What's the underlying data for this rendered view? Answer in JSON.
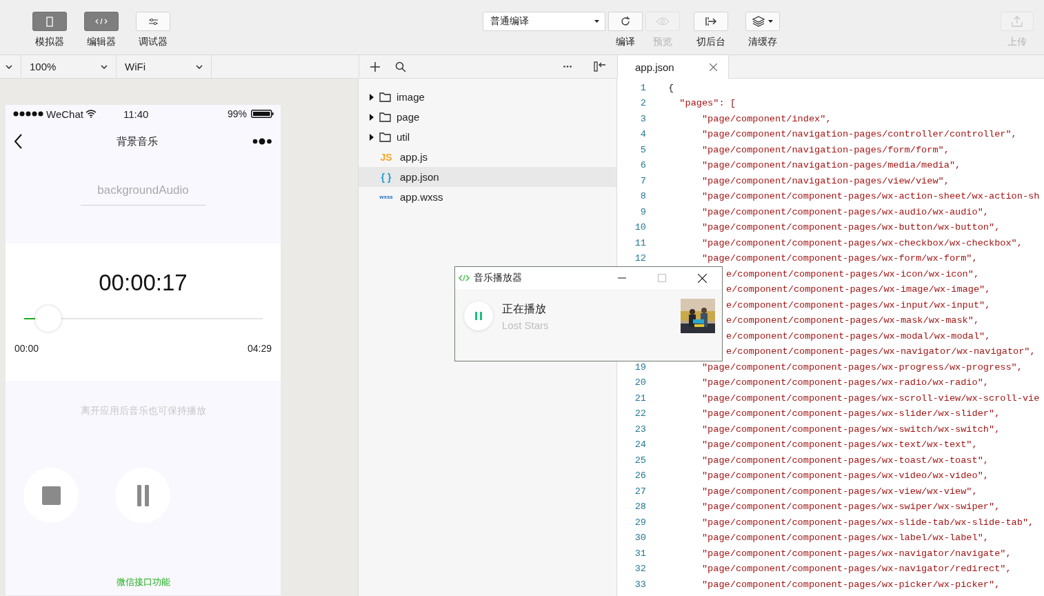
{
  "toolbar": {
    "modes": [
      {
        "label": "模拟器",
        "kind": "simulator",
        "selected": true
      },
      {
        "label": "编辑器",
        "kind": "editor",
        "selected": true
      },
      {
        "label": "调试器",
        "kind": "debugger",
        "selected": false
      }
    ],
    "compile_mode": {
      "value": "普通编译"
    },
    "actions": [
      {
        "label": "编译",
        "kind": "refresh",
        "disabled": false
      },
      {
        "label": "预览",
        "kind": "preview",
        "disabled": true
      }
    ],
    "tools": [
      {
        "label": "切后台",
        "kind": "background"
      },
      {
        "label": "清缓存",
        "kind": "cache"
      }
    ],
    "upload": {
      "label": "上传",
      "disabled": true
    }
  },
  "simulator_bar": {
    "zoom": "100%",
    "network": "WiFi"
  },
  "phone": {
    "status_bar": {
      "carrier": "WeChat",
      "time": "11:40",
      "battery": "99%"
    },
    "nav_title": "背景音乐",
    "section_title": "backgroundAudio",
    "elapsed": "00:00:17",
    "progress": {
      "level": 0.05,
      "start": "00:00",
      "end": "04:29"
    },
    "hint": "离开应用后音乐也可保持播放",
    "controls": [
      {
        "kind": "stop"
      },
      {
        "kind": "pause"
      }
    ],
    "footer": "微信接口功能"
  },
  "file_tree": [
    {
      "name": "image",
      "kind": "folder",
      "selected": false
    },
    {
      "name": "page",
      "kind": "folder",
      "selected": false
    },
    {
      "name": "util",
      "kind": "folder",
      "selected": false
    },
    {
      "name": "app.js",
      "kind": "file",
      "badge": "JS",
      "color": "#f5a623",
      "selected": false
    },
    {
      "name": "app.json",
      "kind": "file",
      "badge": "{ }",
      "color": "#1e9bd7",
      "selected": true
    },
    {
      "name": "app.wxss",
      "kind": "file",
      "badge": "wxss",
      "color": "#1a6fc4",
      "selected": false
    }
  ],
  "editor_tabs": [
    {
      "label": "app.json",
      "selected": true
    }
  ],
  "code_lines": [
    {
      "number": "1",
      "text": "{"
    },
    {
      "number": "2",
      "text": "  \"pages\": ["
    },
    {
      "number": "3",
      "text": "      \"page/component/index\","
    },
    {
      "number": "4",
      "text": "      \"page/component/navigation-pages/controller/controller\","
    },
    {
      "number": "5",
      "text": "      \"page/component/navigation-pages/form/form\","
    },
    {
      "number": "6",
      "text": "      \"page/component/navigation-pages/media/media\","
    },
    {
      "number": "7",
      "text": "      \"page/component/navigation-pages/view/view\","
    },
    {
      "number": "8",
      "text": "      \"page/component/component-pages/wx-action-sheet/wx-action-sh"
    },
    {
      "number": "9",
      "text": "      \"page/component/component-pages/wx-audio/wx-audio\","
    },
    {
      "number": "10",
      "text": "      \"page/component/component-pages/wx-button/wx-button\","
    },
    {
      "number": "11",
      "text": "      \"page/component/component-pages/wx-checkbox/wx-checkbox\","
    },
    {
      "number": "12",
      "text": "      \"page/component/component-pages/wx-form/wx-form\","
    },
    {
      "text": "e/component/component-pages/wx-icon/wx-icon\","
    },
    {
      "text": "e/component/component-pages/wx-image/wx-image\","
    },
    {
      "text": "e/component/component-pages/wx-input/wx-input\","
    },
    {
      "text": "e/component/component-pages/wx-mask/wx-mask\","
    },
    {
      "text": "e/component/component-pages/wx-modal/wx-modal\","
    },
    {
      "text": "e/component/component-pages/wx-navigator/wx-navigator\","
    },
    {
      "number": "19",
      "text": "      \"page/component/component-pages/wx-progress/wx-progress\","
    },
    {
      "number": "20",
      "text": "      \"page/component/component-pages/wx-radio/wx-radio\","
    },
    {
      "number": "21",
      "text": "      \"page/component/component-pages/wx-scroll-view/wx-scroll-vie"
    },
    {
      "number": "22",
      "text": "      \"page/component/component-pages/wx-slider/wx-slider\","
    },
    {
      "number": "23",
      "text": "      \"page/component/component-pages/wx-switch/wx-switch\","
    },
    {
      "number": "24",
      "text": "      \"page/component/component-pages/wx-text/wx-text\","
    },
    {
      "number": "25",
      "text": "      \"page/component/component-pages/wx-toast/wx-toast\","
    },
    {
      "number": "26",
      "text": "      \"page/component/component-pages/wx-video/wx-video\","
    },
    {
      "number": "27",
      "text": "      \"page/component/component-pages/wx-view/wx-view\","
    },
    {
      "number": "28",
      "text": "      \"page/component/component-pages/wx-swiper/wx-swiper\","
    },
    {
      "number": "29",
      "text": "      \"page/component/component-pages/wx-slide-tab/wx-slide-tab\","
    },
    {
      "number": "30",
      "text": "      \"page/component/component-pages/wx-label/wx-label\","
    },
    {
      "number": "31",
      "text": "      \"page/component/component-pages/wx-navigator/navigate\","
    },
    {
      "number": "32",
      "text": "      \"page/component/component-pages/wx-navigator/redirect\","
    },
    {
      "number": "33",
      "text": "      \"page/component/component-pages/wx-picker/wx-picker\","
    }
  ],
  "player_window": {
    "title": "音乐播放器",
    "status": "正在播放",
    "track": "Lost Stars",
    "playing": true
  }
}
